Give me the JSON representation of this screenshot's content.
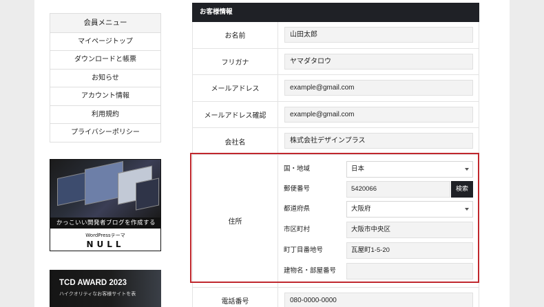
{
  "sidebar": {
    "menu_title": "会員メニュー",
    "items": [
      {
        "label": "マイページトップ"
      },
      {
        "label": "ダウンロードと帳票"
      },
      {
        "label": "お知らせ"
      },
      {
        "label": "アカウント情報"
      },
      {
        "label": "利用規約"
      },
      {
        "label": "プライバシーポリシー"
      }
    ],
    "banner1": {
      "tagline": "かっこいい開発者ブログを作成する",
      "subtitle": "WordPressテーマ",
      "logo": "NULL"
    },
    "banner2": {
      "title": "TCD AWARD 2023",
      "subtitle": "ハイクオリティなお客様サイトを表"
    }
  },
  "form": {
    "header": "お客様情報",
    "rows": [
      {
        "label": "お名前",
        "value": "山田太郎"
      },
      {
        "label": "フリガナ",
        "value": "ヤマダタロウ"
      },
      {
        "label": "メールアドレス",
        "value": "example@gmail.com"
      },
      {
        "label": "メールアドレス確認",
        "value": "example@gmail.com"
      },
      {
        "label": "会社名",
        "value": "株式会社デザインプラス"
      }
    ],
    "address": {
      "label": "住所",
      "fields": [
        {
          "label": "国・地域",
          "value": "日本"
        },
        {
          "label": "郵便番号",
          "value": "5420066"
        },
        {
          "label": "都道府県",
          "value": "大阪府"
        },
        {
          "label": "市区町村",
          "value": "大阪市中央区"
        },
        {
          "label": "町丁目番地号",
          "value": "瓦屋町1-5-20"
        },
        {
          "label": "建物名・部屋番号",
          "value": ""
        }
      ],
      "search_button": "検索"
    },
    "phone": {
      "label": "電話番号",
      "value": "080-0000-0000"
    }
  },
  "colors": {
    "highlight": "#c0272d",
    "header_bg": "#1f2126"
  }
}
